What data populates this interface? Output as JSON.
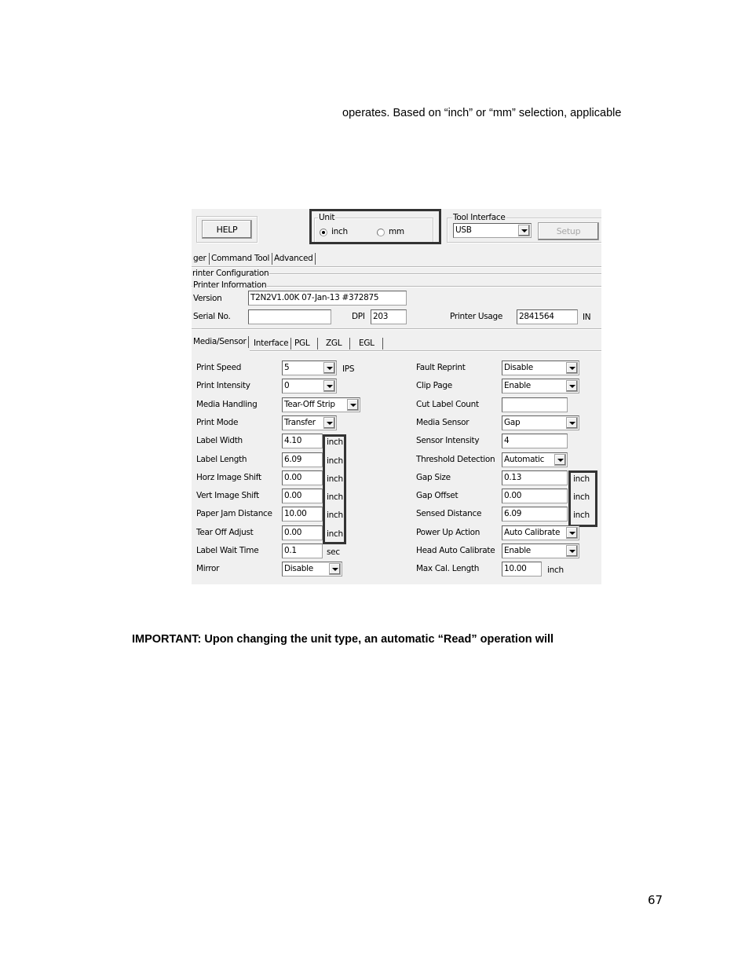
{
  "document": {
    "intro_text": "operates. Based on “inch” or “mm” selection, applicable",
    "important_text": "IMPORTANT: Upon changing the unit type, an automatic “Read” operation will",
    "page_number": "67"
  },
  "screenshot": {
    "help_button": "HELP",
    "unit_group": {
      "legend": "Unit",
      "options": [
        {
          "label": "inch",
          "selected": true
        },
        {
          "label": "mm",
          "selected": false
        }
      ]
    },
    "tool_interface": {
      "legend": "Tool Interface",
      "selected": "USB",
      "setup_button": "Setup"
    },
    "main_tabs": [
      "ger",
      "Command Tool",
      "Advanced"
    ],
    "printer_configuration_legend": "rinter Configuration",
    "printer_information": {
      "legend": "Printer Information",
      "version_label": "Version",
      "version_value": "T2N2V1.00K 07-Jan-13 #372875",
      "serial_label": "Serial No.",
      "serial_value": "",
      "dpi_label": "DPI",
      "dpi_value": "203",
      "usage_label": "Printer Usage",
      "usage_value": "2841564",
      "usage_unit": "IN"
    },
    "sub_tabs": [
      "Media/Sensor",
      "Interface",
      "PGL",
      "ZGL",
      "EGL"
    ],
    "left_fields": [
      {
        "label": "Print Speed",
        "value": "5",
        "type": "select",
        "unit": "IPS"
      },
      {
        "label": "Print Intensity",
        "value": "0",
        "type": "select",
        "unit": ""
      },
      {
        "label": "Media Handling",
        "value": "Tear-Off Strip",
        "type": "select",
        "unit": ""
      },
      {
        "label": "Print Mode",
        "value": "Transfer",
        "type": "select",
        "unit": ""
      },
      {
        "label": "Label Width",
        "value": "4.10",
        "type": "input",
        "unit": "inch"
      },
      {
        "label": "Label Length",
        "value": "6.09",
        "type": "input",
        "unit": "inch"
      },
      {
        "label": "Horz Image Shift",
        "value": "0.00",
        "type": "input",
        "unit": "inch"
      },
      {
        "label": "Vert Image Shift",
        "value": "0.00",
        "type": "input",
        "unit": "inch"
      },
      {
        "label": "Paper Jam Distance",
        "value": "10.00",
        "type": "input",
        "unit": "inch"
      },
      {
        "label": "Tear Off Adjust",
        "value": "0.00",
        "type": "input",
        "unit": "inch"
      },
      {
        "label": "Label Wait Time",
        "value": "0.1",
        "type": "input",
        "unit": "sec"
      },
      {
        "label": "Mirror",
        "value": "Disable",
        "type": "select",
        "unit": ""
      }
    ],
    "right_fields": [
      {
        "label": "Fault Reprint",
        "value": "Disable",
        "type": "select",
        "unit": ""
      },
      {
        "label": "Clip Page",
        "value": "Enable",
        "type": "select",
        "unit": ""
      },
      {
        "label": "Cut Label Count",
        "value": "",
        "type": "input",
        "unit": ""
      },
      {
        "label": "Media Sensor",
        "value": "Gap",
        "type": "select",
        "unit": ""
      },
      {
        "label": "Sensor Intensity",
        "value": "4",
        "type": "input",
        "unit": ""
      },
      {
        "label": "Threshold Detection",
        "value": "Automatic",
        "type": "select",
        "unit": ""
      },
      {
        "label": "Gap Size",
        "value": "0.13",
        "type": "input",
        "unit": "inch"
      },
      {
        "label": "Gap Offset",
        "value": "0.00",
        "type": "input",
        "unit": "inch"
      },
      {
        "label": "Sensed Distance",
        "value": "6.09",
        "type": "input",
        "unit": "inch"
      },
      {
        "label": "Power Up Action",
        "value": "Auto Calibrate",
        "type": "select",
        "unit": ""
      },
      {
        "label": "Head Auto Calibrate",
        "value": "Enable",
        "type": "select",
        "unit": ""
      },
      {
        "label": "Max Cal. Length",
        "value": "10.00",
        "type": "input",
        "unit": "inch"
      }
    ]
  }
}
